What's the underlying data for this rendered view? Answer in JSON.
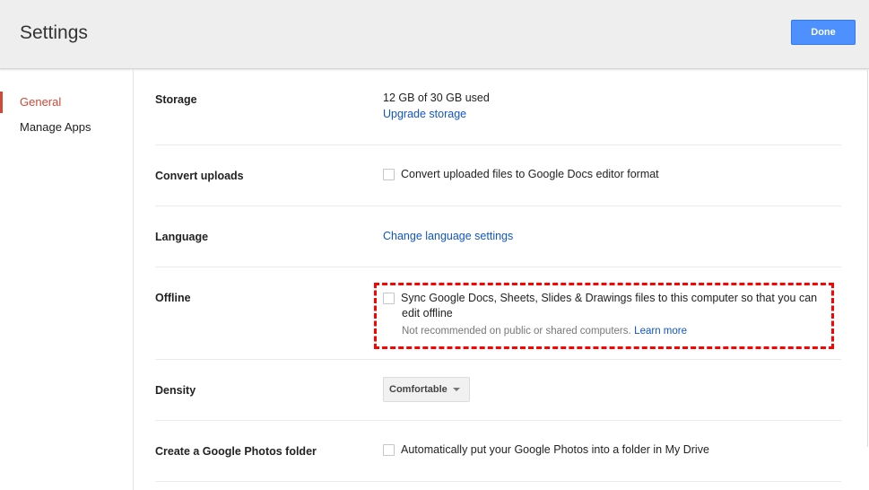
{
  "header": {
    "title": "Settings",
    "done_label": "Done"
  },
  "sidebar": {
    "items": [
      {
        "label": "General",
        "active": true
      },
      {
        "label": "Manage Apps",
        "active": false
      }
    ]
  },
  "settings": {
    "storage": {
      "label": "Storage",
      "usage": "12 GB of 30 GB used",
      "link": "Upgrade storage"
    },
    "convert": {
      "label": "Convert uploads",
      "checkbox": "Convert uploaded files to Google Docs editor format",
      "checked": false
    },
    "language": {
      "label": "Language",
      "link": "Change language settings"
    },
    "offline": {
      "label": "Offline",
      "checkbox": "Sync Google Docs, Sheets, Slides & Drawings files to this computer so that you can",
      "checkbox_line2": "edit offline",
      "checked": false,
      "note": "Not recommended on public or shared computers.",
      "learn_more": "Learn more"
    },
    "density": {
      "label": "Density",
      "selected": "Comfortable"
    },
    "photos": {
      "label": "Create a Google Photos folder",
      "checkbox": "Automatically put your Google Photos into a folder in My Drive",
      "checked": false
    }
  },
  "colors": {
    "accent": "#d14836",
    "primary_button": "#4d90fe",
    "link": "#1155cc",
    "highlight": "#ff0000"
  }
}
